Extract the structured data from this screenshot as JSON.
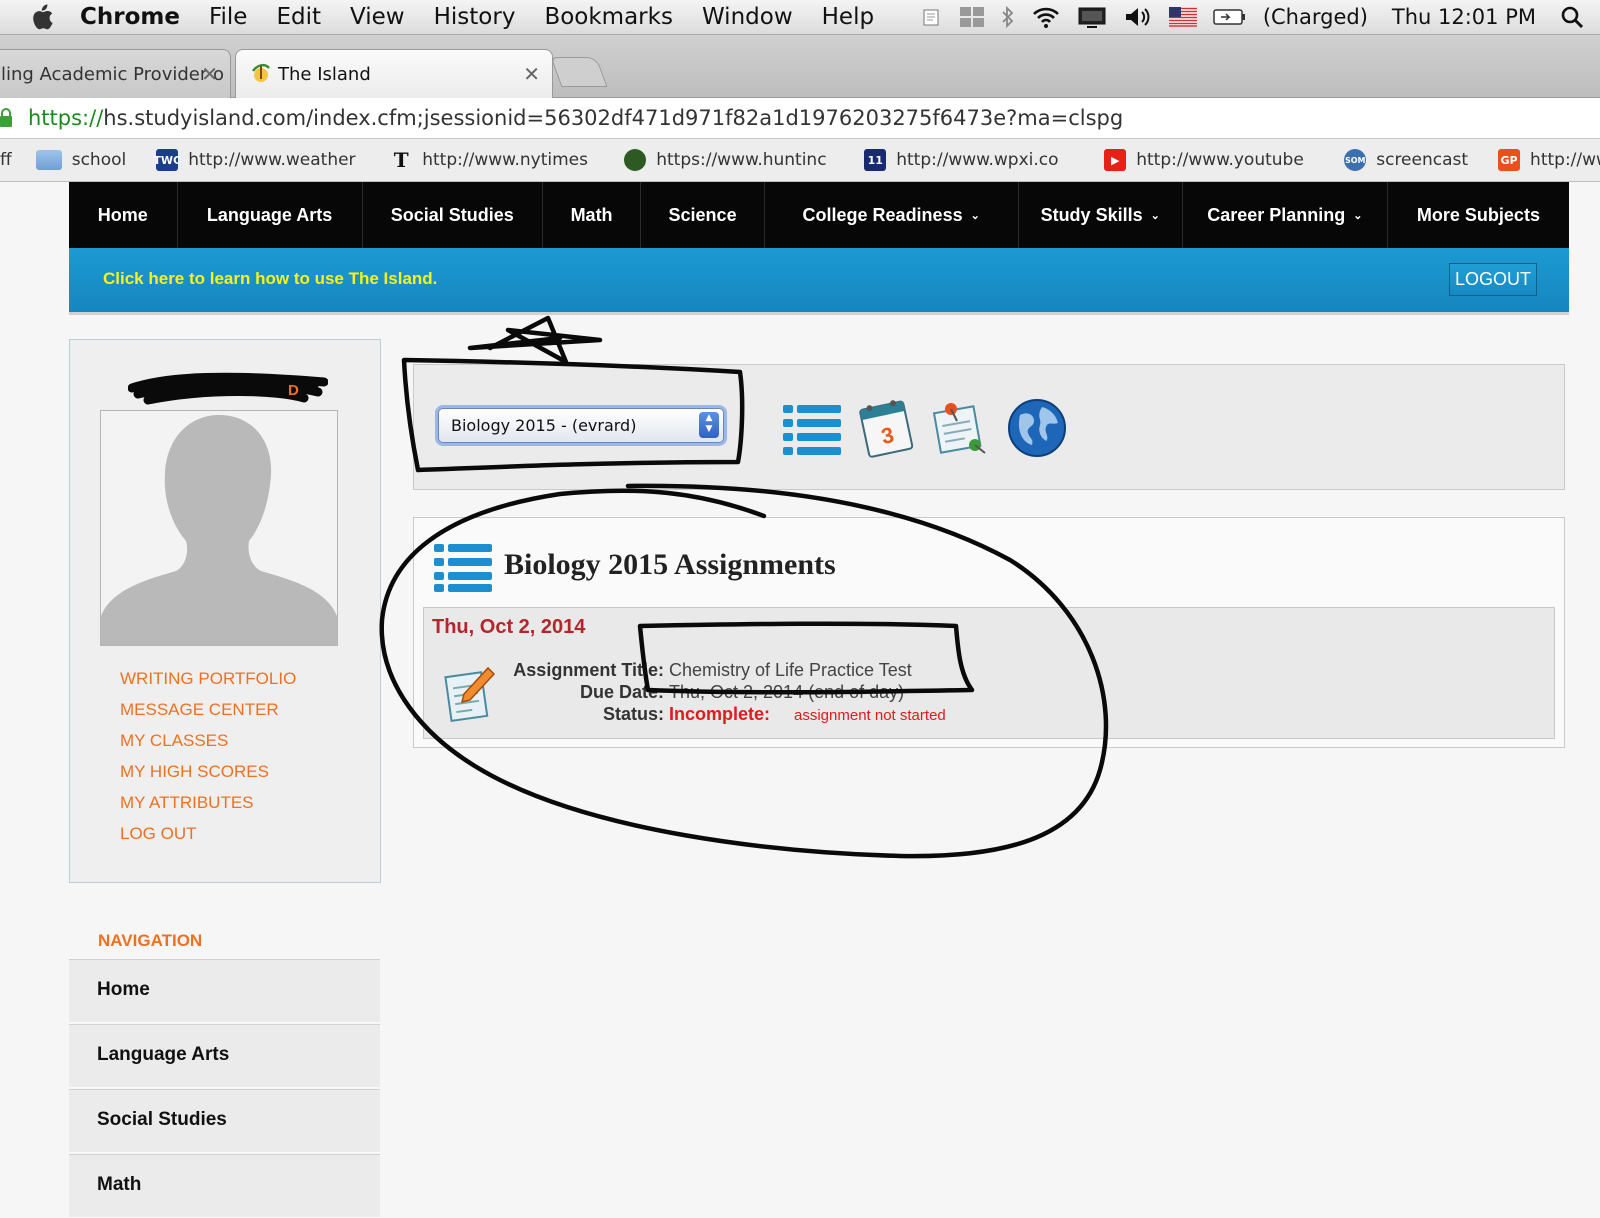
{
  "menubar": {
    "app": "Chrome",
    "items": [
      "File",
      "Edit",
      "View",
      "History",
      "Bookmarks",
      "Window",
      "Help"
    ],
    "battery": "(Charged)",
    "clock": "Thu 12:01 PM"
  },
  "tabs": [
    {
      "label": "ling Academic Provider o",
      "active": false
    },
    {
      "label": "The Island",
      "active": true
    }
  ],
  "address": {
    "scheme": "https://",
    "rest": "hs.studyisland.com/index.cfm;jsessionid=56302df471d971f82a1d1976203275f6473e?ma=clspg"
  },
  "bookmarks": [
    {
      "label": "ff",
      "icon": "none"
    },
    {
      "label": "school",
      "icon": "folder-icon"
    },
    {
      "label": "http://www.weather",
      "icon": "twc-icon"
    },
    {
      "label": "http://www.nytimes",
      "icon": "nyt-icon"
    },
    {
      "label": "https://www.huntinc",
      "icon": "hunting-icon"
    },
    {
      "label": "http://www.wpxi.co",
      "icon": "wpxi-icon"
    },
    {
      "label": "http://www.youtube",
      "icon": "youtube-icon"
    },
    {
      "label": "screencast",
      "icon": "screencast-icon"
    },
    {
      "label": "http://www",
      "icon": "gp-icon"
    }
  ],
  "topnav": [
    {
      "label": "Home",
      "dropdown": false
    },
    {
      "label": "Language Arts",
      "dropdown": false
    },
    {
      "label": "Social Studies",
      "dropdown": false
    },
    {
      "label": "Math",
      "dropdown": false
    },
    {
      "label": "Science",
      "dropdown": false
    },
    {
      "label": "College Readiness",
      "dropdown": true
    },
    {
      "label": "Study Skills",
      "dropdown": true
    },
    {
      "label": "Career Planning",
      "dropdown": true
    },
    {
      "label": "More Subjects",
      "dropdown": false
    }
  ],
  "banner": {
    "learn_link": "Click here to learn how to use The Island.",
    "logout": "LOGOUT"
  },
  "profile": {
    "name_visible_tail": "D",
    "links": [
      "WRITING PORTFOLIO",
      "MESSAGE CENTER",
      "MY CLASSES",
      "MY HIGH SCORES",
      "MY ATTRIBUTES",
      "LOG OUT"
    ]
  },
  "sidebar": {
    "heading": "NAVIGATION",
    "items": [
      "Home",
      "Language Arts",
      "Social Studies",
      "Math"
    ]
  },
  "class_select": {
    "value": "Biology 2015 - (evrard)"
  },
  "toolbar_icons": [
    "list-icon",
    "calendar-icon",
    "notepad-pin-icon",
    "globe-icon"
  ],
  "calendar_day": "3",
  "assignments": {
    "title": "Biology 2015 Assignments",
    "entries": [
      {
        "date": "Thu, Oct 2, 2014",
        "title_label": "Assignment Title:",
        "title_value": "Chemistry of Life Practice Test",
        "due_label": "Due Date:",
        "due_value": "Thu, Oct 2, 2014 (end of day)",
        "status_label": "Status:",
        "status_value": "Incomplete:",
        "status_note": "assignment not started"
      }
    ]
  },
  "colors": {
    "nav_bg": "#070707",
    "banner_blue": "#1a92cc",
    "banner_link": "#f6f21a",
    "accent_orange": "#f07020",
    "date_red": "#b3262c",
    "status_red": "#e01b1b"
  }
}
